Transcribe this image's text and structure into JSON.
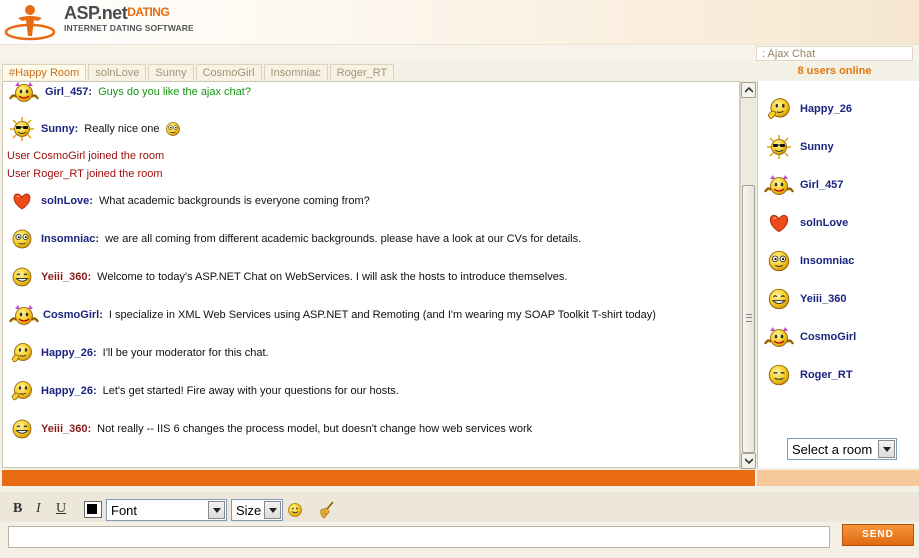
{
  "header": {
    "logo_main": "ASP.net",
    "logo_highlight": "DATING",
    "logo_sub": "INTERNET DATING SOFTWARE"
  },
  "panel_title": ": Ajax Chat",
  "online_count": "8 users online",
  "tabs": [
    {
      "label": "#Happy Room",
      "active": true
    },
    {
      "label": "solnLove"
    },
    {
      "label": "Sunny"
    },
    {
      "label": "CosmoGirl"
    },
    {
      "label": "Insomniac"
    },
    {
      "label": "Roger_RT"
    }
  ],
  "messages": [
    {
      "user": "Girl_457:",
      "text": "Guys do you like the ajax chat?",
      "avatar": "girl-smiley-icon"
    },
    {
      "user": "Sunny:",
      "text": "Really nice one",
      "avatar": "sunglasses-sun-icon"
    },
    {
      "system": "User CosmoGirl joined the room"
    },
    {
      "system": "User Roger_RT joined the room"
    },
    {
      "user": "solnLove:",
      "text": "What academic backgrounds is everyone coming from?",
      "avatar": "heart-icon"
    },
    {
      "user": "Insomniac:",
      "text": "we are all coming from different academic backgrounds. please have a look at our CVs for details.",
      "avatar": "wide-eyed-smiley-icon"
    },
    {
      "user": "Yeiii_360:",
      "text": "Welcome to today's ASP.NET Chat on WebServices. I will ask the hosts to introduce themselves.",
      "avatar": "grin-smiley-icon"
    },
    {
      "user": "CosmoGirl:",
      "text": "I specialize in XML Web Services using ASP.NET and Remoting (and I'm wearing my SOAP Toolkit T-shirt today)",
      "avatar": "girl-smiley-icon"
    },
    {
      "user": "Happy_26:",
      "text": "I'll be your moderator for this chat.",
      "avatar": "thinking-smiley-icon"
    },
    {
      "user": "Happy_26:",
      "text": "Let's get started! Fire away with your questions for our hosts.",
      "avatar": "thinking-smiley-icon"
    },
    {
      "user": "Yeiii_360:",
      "text": "Not really -- IIS 6 changes the process model, but doesn't change how web services work",
      "avatar": "grin-smiley-icon"
    }
  ],
  "users": [
    {
      "name": "Happy_26",
      "avatar": "thinking-smiley-icon"
    },
    {
      "name": "Sunny",
      "avatar": "sunglasses-sun-icon"
    },
    {
      "name": "Girl_457",
      "avatar": "girl-smiley-icon"
    },
    {
      "name": "solnLove",
      "avatar": "heart-icon"
    },
    {
      "name": "Insomniac",
      "avatar": "wide-eyed-smiley-icon"
    },
    {
      "name": "Yeiii_360",
      "avatar": "grin-smiley-icon"
    },
    {
      "name": "CosmoGirl",
      "avatar": "girl-smiley-icon"
    },
    {
      "name": "Roger_RT",
      "avatar": "sleepy-smiley-icon"
    }
  ],
  "room_select": {
    "selected": "Select a room"
  },
  "toolbar": {
    "bold": "B",
    "italic": "I",
    "underline": "U",
    "font_select": "Font",
    "size_select": "Size"
  },
  "input": {
    "value": "",
    "placeholder": ""
  },
  "send_label": "SEND",
  "colors": {
    "accent": "#e86a12",
    "user_name": "#1a237e",
    "system": "#a01010",
    "green_text": "#159612"
  }
}
